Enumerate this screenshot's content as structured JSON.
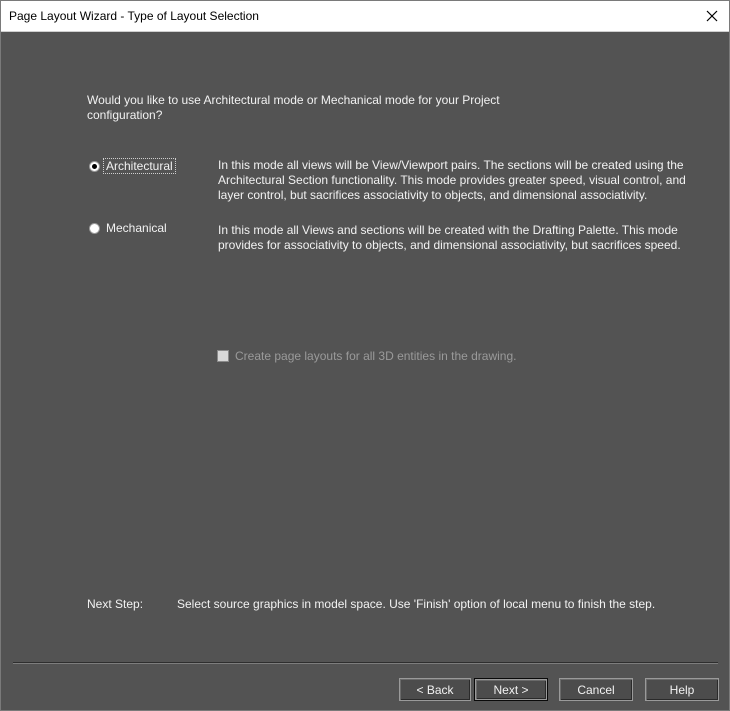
{
  "window": {
    "title": "Page Layout Wizard - Type of Layout Selection"
  },
  "question": "Would you like to use Architectural mode or Mechanical mode for your Project configuration?",
  "modes": [
    {
      "label": "Architectural",
      "selected": true,
      "description": "In this mode all views will be View/Viewport pairs. The sections will be created using the Architectural Section functionality. This mode provides greater speed, visual control, and layer control, but sacrifices associativity to objects, and dimensional associativity."
    },
    {
      "label": "Mechanical",
      "selected": false,
      "description": "In this mode all Views and sections will be created with the Drafting Palette. This mode provides for associativity to objects, and dimensional associativity, but sacrifices speed."
    }
  ],
  "option": {
    "label": "Create page layouts for all 3D entities in the drawing.",
    "checked": false,
    "enabled": false
  },
  "next_step": {
    "label": "Next Step:",
    "text": "Select source graphics in model space. Use 'Finish' option of local menu to finish the step."
  },
  "buttons": {
    "back": "< Back",
    "next": "Next >",
    "cancel": "Cancel",
    "help": "Help"
  },
  "icons": {
    "close": "close-icon"
  },
  "colors": {
    "dialog_background": "#535353",
    "titlebar_background": "#ffffff",
    "text": "#f2f2f2",
    "disabled_text": "#9a9a9a"
  }
}
